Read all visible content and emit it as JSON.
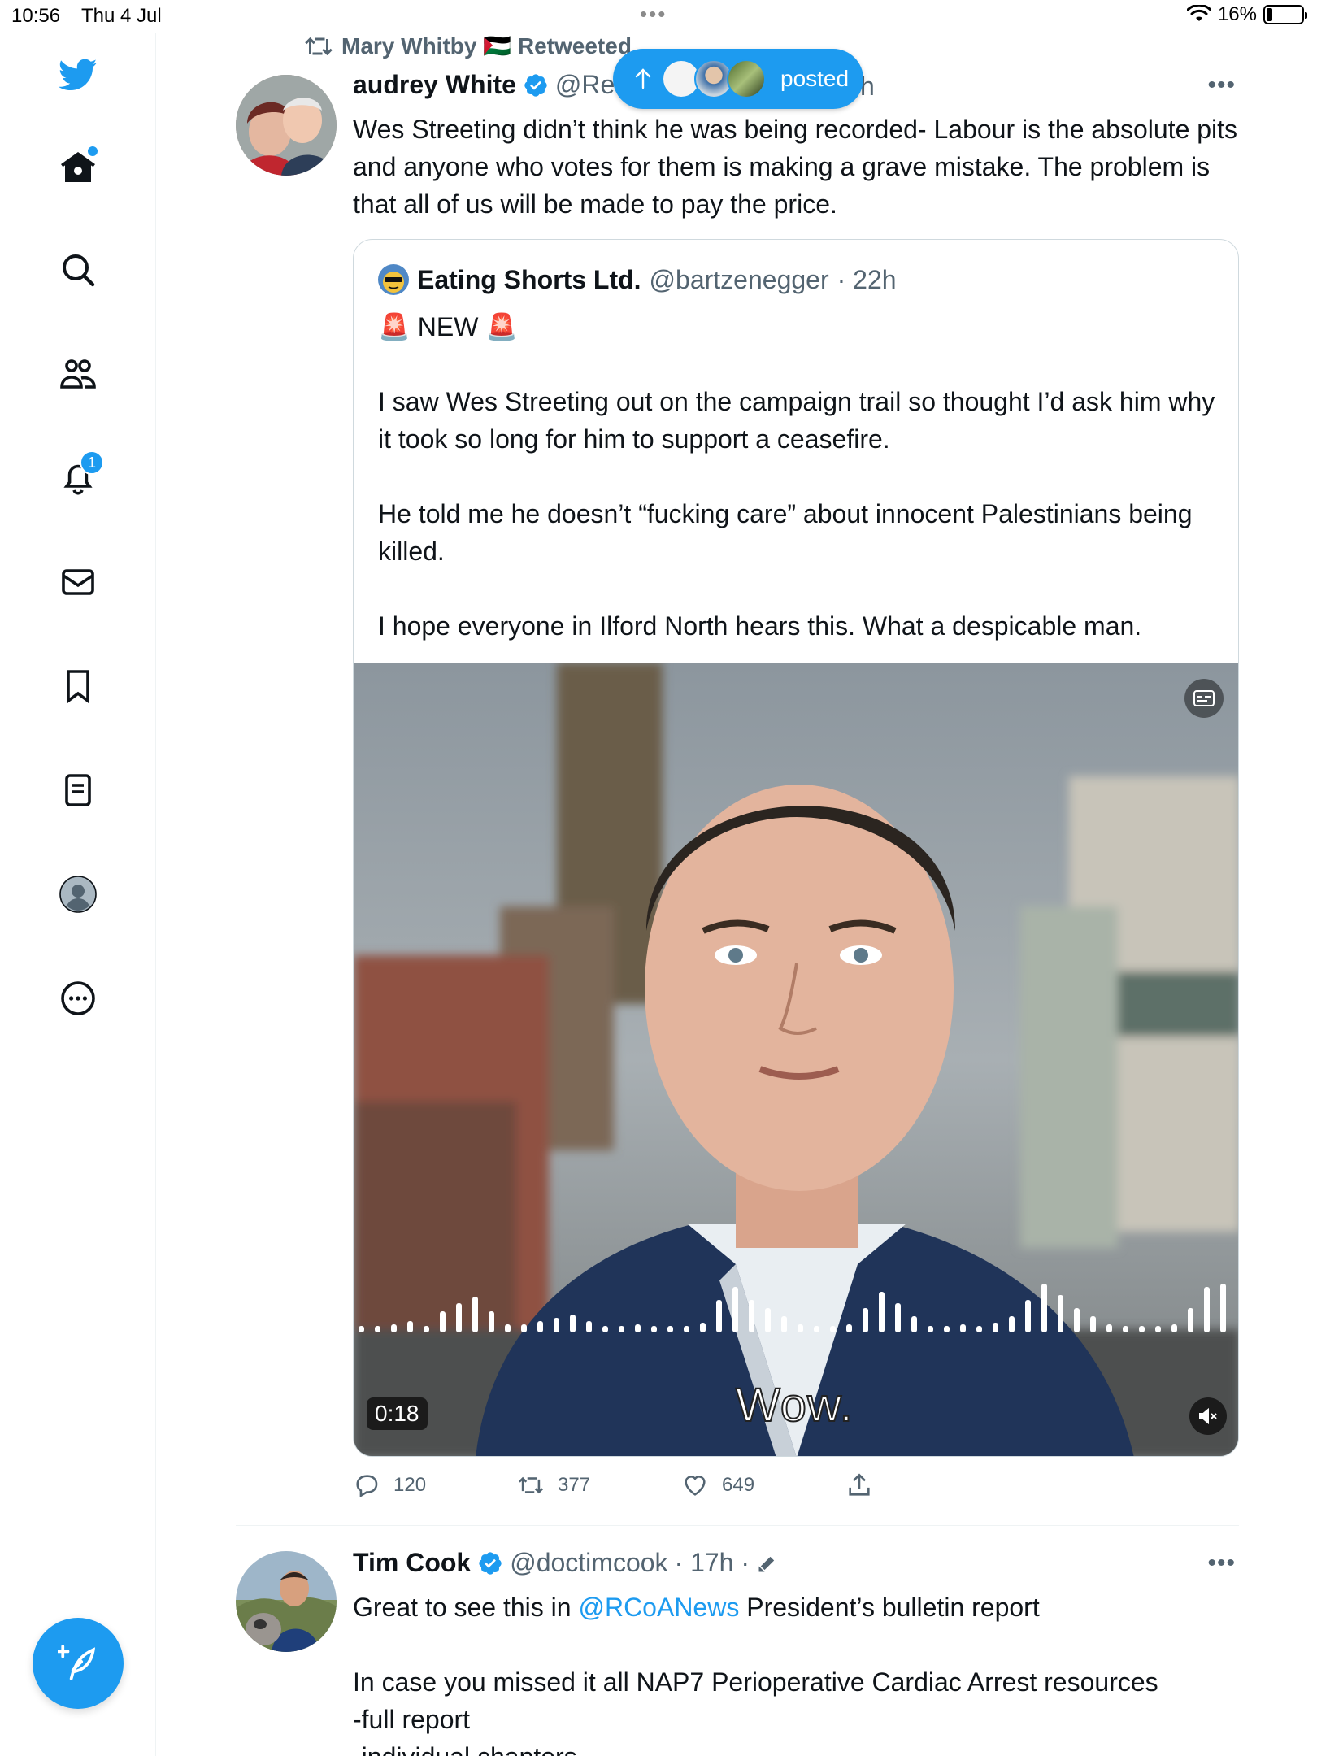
{
  "status_bar": {
    "time": "10:56",
    "date": "Thu 4 Jul",
    "battery": "16%",
    "battery_level": 0.16
  },
  "sidebar": {
    "items": [
      {
        "name": "twitter-logo",
        "icon": "bird-icon"
      },
      {
        "name": "home",
        "icon": "home-icon"
      },
      {
        "name": "explore",
        "icon": "search-icon"
      },
      {
        "name": "communities",
        "icon": "people-icon"
      },
      {
        "name": "notifications",
        "icon": "bell-icon",
        "badge": "1"
      },
      {
        "name": "messages",
        "icon": "mail-icon"
      },
      {
        "name": "bookmarks",
        "icon": "bookmark-icon"
      },
      {
        "name": "lists",
        "icon": "list-icon"
      },
      {
        "name": "profile",
        "icon": "profile-icon"
      },
      {
        "name": "more",
        "icon": "more-icon"
      }
    ],
    "compose_icon": "compose-icon"
  },
  "posted_pill": {
    "label": "posted"
  },
  "tweet1": {
    "retweeted_by": "Mary Whitby 🇵🇸 Retweeted",
    "author_name": "audrey White",
    "author_handle": "@Re",
    "time_fragment": "h",
    "text": "Wes Streeting didn’t think he was being recorded- Labour is the absolute pits and anyone who votes for them is making a grave mistake. The problem is that all of us will be made to pay the price.",
    "quote": {
      "author_name": "Eating Shorts Ltd.",
      "author_handle": "@bartzenegger",
      "time": "· 22h",
      "paragraphs": [
        "🚨 NEW 🚨",
        "I saw Wes Streeting out on the campaign trail so thought I’d ask him why it took so long for him to support a ceasefire.",
        "He told me he doesn’t “fucking care” about innocent Palestinians being killed.",
        "I hope everyone in Ilford North hears this. What a despicable man."
      ],
      "media": {
        "caption": "Wow.",
        "duration": "0:18"
      }
    },
    "actions": {
      "replies": "120",
      "retweets": "377",
      "likes": "649"
    }
  },
  "tweet2": {
    "author_name": "Tim Cook",
    "author_handle": "@doctimcook",
    "time": "· 17h ·",
    "text_prefix": "Great to see this in ",
    "mention": "@RCoANews",
    "text_suffix": " President’s bulletin report",
    "line2": "In case you missed it all NAP7 Perioperative Cardiac Arrest resources",
    "line3": "-full report",
    "line4": "-individual chapters"
  },
  "colors": {
    "brand": "#1d9bf0",
    "text_primary": "#0f1419",
    "text_secondary": "#536471",
    "border": "#cfd9de"
  }
}
